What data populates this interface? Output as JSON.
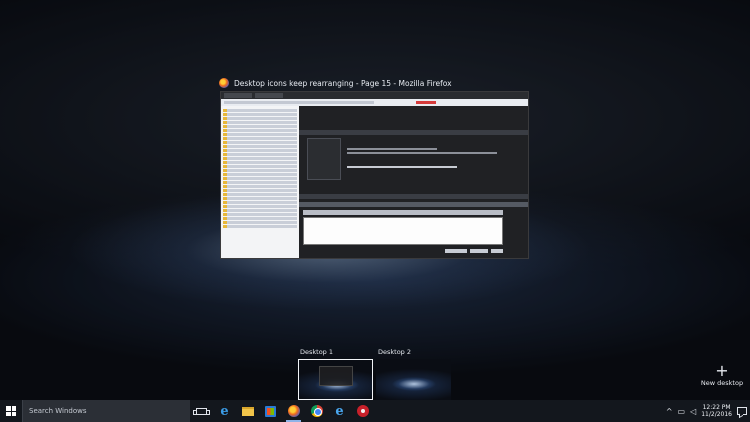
{
  "task_view": {
    "window_title": "Desktop icons keep rearranging - Page 15 - Mozilla Firefox",
    "window_icon": "firefox-icon",
    "desktops": [
      {
        "label": "Desktop 1",
        "active": true
      },
      {
        "label": "Desktop 2",
        "active": false
      }
    ],
    "new_desktop_label": "New desktop",
    "new_desktop_glyph": "+"
  },
  "taskbar": {
    "search_placeholder": "Search Windows",
    "pinned": [
      {
        "name": "task-view",
        "icon": "task-view-icon"
      },
      {
        "name": "edge",
        "icon": "edge-icon",
        "glyph": "e"
      },
      {
        "name": "file-explorer",
        "icon": "folder-icon"
      },
      {
        "name": "store",
        "icon": "store-icon"
      },
      {
        "name": "firefox",
        "icon": "firefox-icon"
      },
      {
        "name": "chrome",
        "icon": "chrome-icon"
      },
      {
        "name": "internet-explorer",
        "icon": "ie-icon",
        "glyph": "e"
      },
      {
        "name": "tool",
        "icon": "tool-icon"
      }
    ],
    "tray": {
      "chevron": "^",
      "time": "12:22 PM",
      "date": "11/2/2016"
    }
  },
  "colors": {
    "taskbar": "#13171d",
    "search_box": "#2b2f36",
    "running_indicator": "#8fb3e8",
    "active_thumb_border": "#f2f4f8"
  }
}
